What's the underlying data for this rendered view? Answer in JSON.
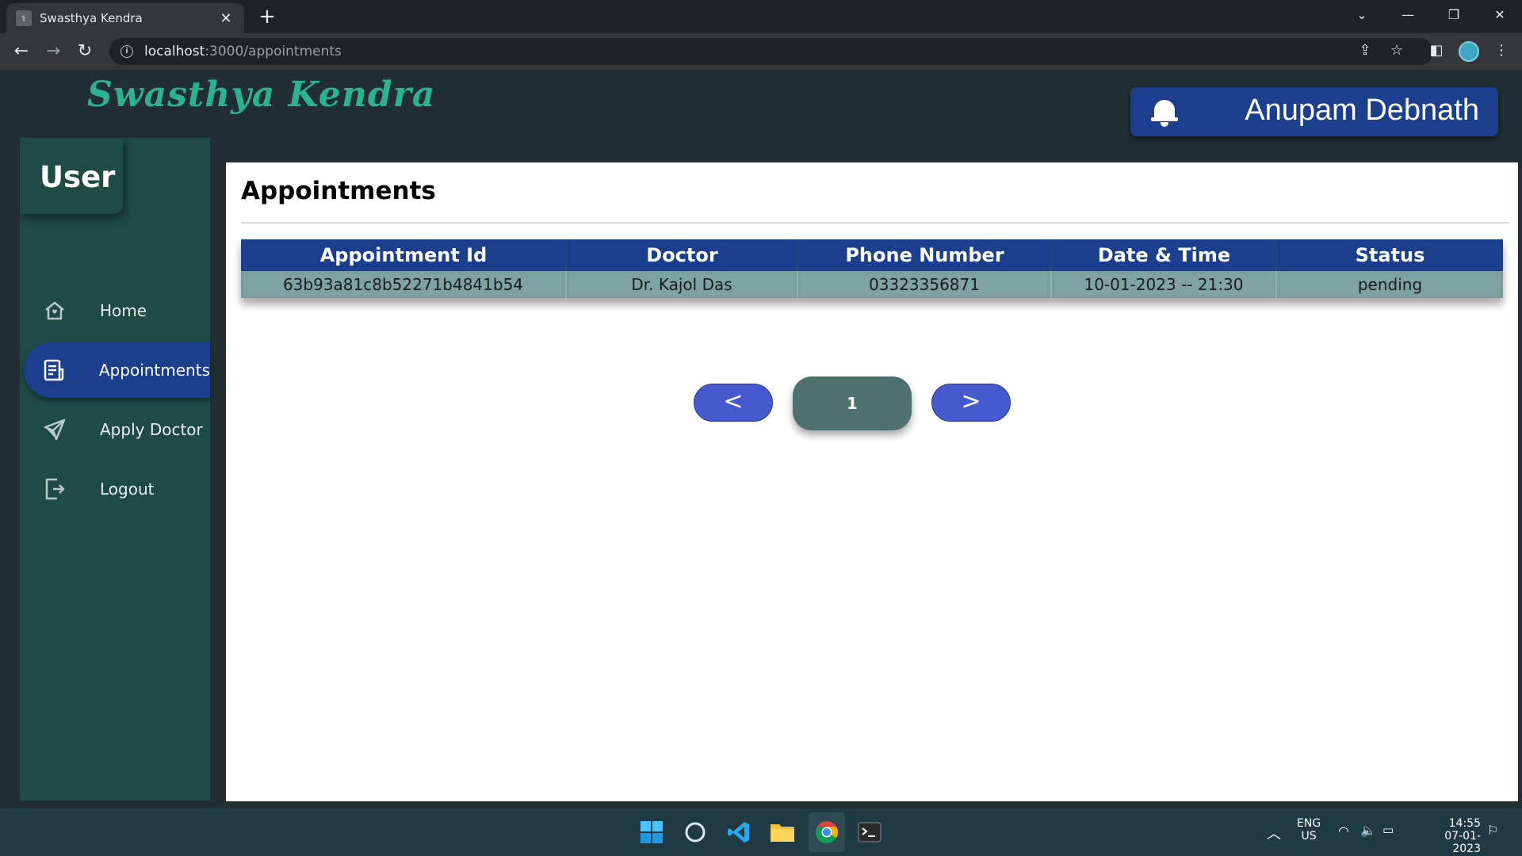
{
  "browser": {
    "tab_title": "Swasthya Kendra",
    "url_host": "localhost",
    "url_path": ":3000/appointments"
  },
  "app": {
    "brand": "Swasthya Kendra",
    "user_name": "Anupam Debnath",
    "role": "User"
  },
  "sidebar": {
    "items": [
      {
        "label": "Home",
        "icon": "home-icon"
      },
      {
        "label": "Appointments",
        "icon": "document-icon",
        "active": true
      },
      {
        "label": "Apply Doctor",
        "icon": "send-icon"
      },
      {
        "label": "Logout",
        "icon": "logout-icon"
      }
    ]
  },
  "main": {
    "title": "Appointments",
    "table": {
      "headers": [
        "Appointment Id",
        "Doctor",
        "Phone Number",
        "Date & Time",
        "Status"
      ],
      "rows": [
        [
          "63b93a81c8b52271b4841b54",
          "Dr. Kajol Das",
          "03323356871",
          "10-01-2023 -- 21:30",
          "pending"
        ]
      ]
    },
    "pagination": {
      "prev": "<",
      "current": "1",
      "next": ">"
    }
  },
  "taskbar": {
    "lang_top": "ENG",
    "lang_bottom": "US",
    "time": "14:55",
    "date": "07-01-2023"
  },
  "colors": {
    "app_bg": "#212f35",
    "sidebar_bg": "#1f4a46",
    "brand": "#2ab391",
    "accent_blue": "#1b3f8c",
    "row_bg": "#7fa3a2",
    "pager_blue": "#4759cf",
    "pager_current": "#4f706c"
  }
}
